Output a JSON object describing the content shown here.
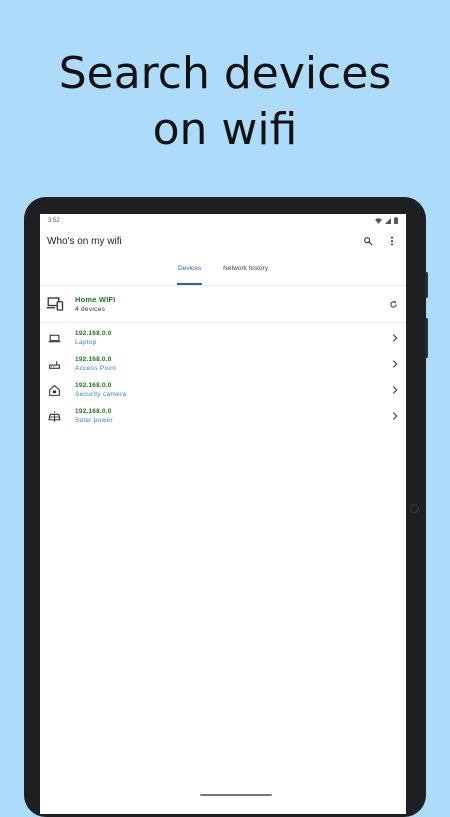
{
  "headline": {
    "line1": "Search devices",
    "line2": "on wifi"
  },
  "status_bar": {
    "time": "3:52",
    "icons": [
      "wifi-icon",
      "signal-icon",
      "battery-icon"
    ]
  },
  "app_bar": {
    "title": "Who's on my wifi",
    "actions": [
      "search-icon",
      "more-vert-icon"
    ]
  },
  "tabs": [
    {
      "label": "Devices",
      "active": true
    },
    {
      "label": "Network history",
      "active": false
    }
  ],
  "network": {
    "name": "Home WIFI",
    "device_count": "4 devices",
    "icon": "devices-icon",
    "action_icon": "refresh-icon"
  },
  "devices": [
    {
      "ip": "192.168.0.0",
      "type": "Laptop",
      "icon": "laptop-icon"
    },
    {
      "ip": "192.168.0.0",
      "type": "Access Point",
      "icon": "router-icon"
    },
    {
      "ip": "192.168.0.0",
      "type": "Security camera",
      "icon": "home-camera-icon"
    },
    {
      "ip": "192.168.0.0",
      "type": "Solar power",
      "icon": "solar-panel-icon"
    }
  ],
  "colors": {
    "background": "#addcfa",
    "accent": "#2a62b8",
    "ip_green": "#1a7a24",
    "type_blue": "#3b7fd0"
  }
}
